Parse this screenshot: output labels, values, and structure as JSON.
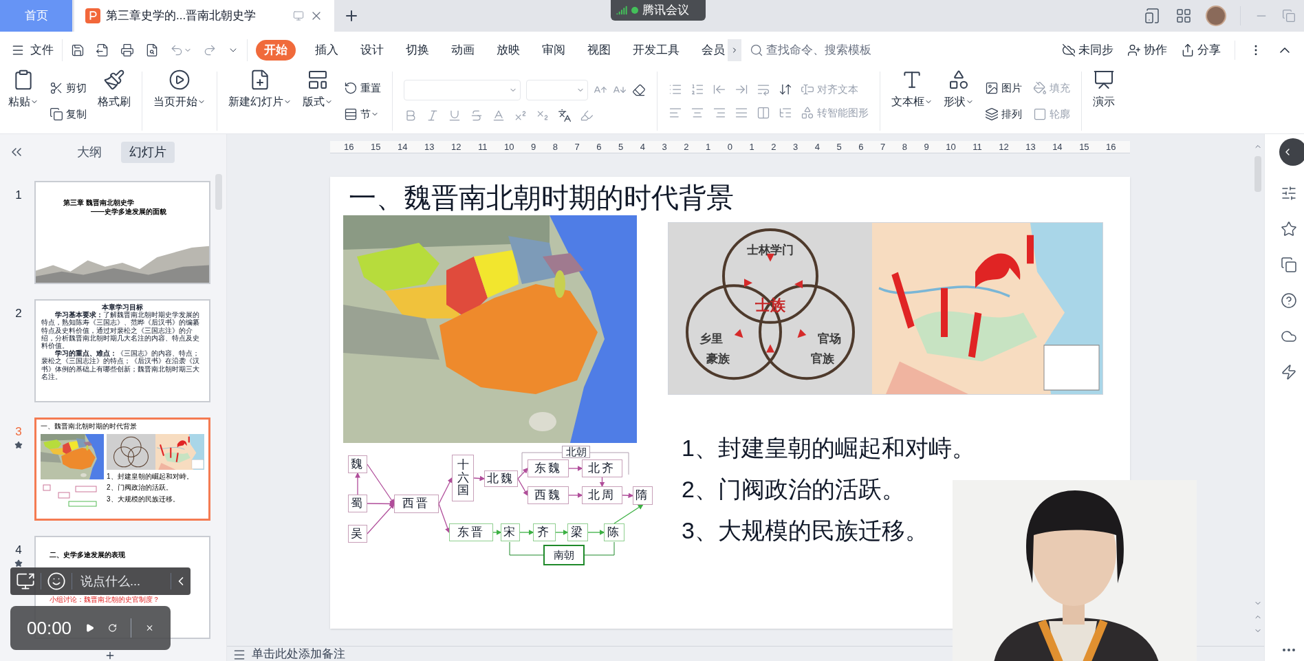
{
  "tabbar": {
    "home": "首页",
    "doc_tab": {
      "title": "第三章史学的...晋南北朝史学",
      "selected": true
    }
  },
  "meeting_badge": "腾讯会议",
  "menu": {
    "file": "文件",
    "tabs": [
      {
        "label": "开始",
        "selected": true
      },
      {
        "label": "插入",
        "selected": false
      },
      {
        "label": "设计",
        "selected": false
      },
      {
        "label": "切换",
        "selected": false
      },
      {
        "label": "动画",
        "selected": false
      },
      {
        "label": "放映",
        "selected": false
      },
      {
        "label": "审阅",
        "selected": false
      },
      {
        "label": "视图",
        "selected": false
      },
      {
        "label": "开发工具",
        "selected": false
      },
      {
        "label": "会员",
        "selected": false
      }
    ],
    "search": {
      "placeholder": "查找命令、搜索模板"
    },
    "right": [
      "未同步",
      "协作",
      "分享"
    ]
  },
  "ribbon": {
    "paste": "粘贴",
    "cut": "剪切",
    "copy": "复制",
    "format_painter": "格式刷",
    "from_current": "当页开始",
    "new_slide": "新建幻灯片",
    "layout": "版式",
    "reset": "重置",
    "section": "节",
    "align_text": {
      "label": "对齐文本",
      "disabled": true
    },
    "smart_art": {
      "label": "转智能图形",
      "disabled": true
    },
    "textbox": "文本框",
    "shape": "形状",
    "picture": {
      "label": "图片",
      "disabled": false
    },
    "arrange": {
      "label": "排列",
      "disabled": false
    },
    "fill": {
      "label": "填充",
      "disabled": true
    },
    "outline": {
      "label": "轮廓",
      "disabled": true
    },
    "present": "演示"
  },
  "sidebar": {
    "tabs": [
      {
        "label": "大纲",
        "selected": false
      },
      {
        "label": "幻灯片",
        "selected": true
      }
    ],
    "slides": [
      {
        "number": "1",
        "selected": false,
        "animated": false,
        "kind": "title",
        "title": "第三章 魏晋南北朝史学",
        "subtitle": "——史学多途发展的面貌"
      },
      {
        "number": "2",
        "selected": false,
        "animated": false,
        "kind": "goals",
        "title": "本章学习目标",
        "paragraphs": [
          "**学习基本要求：**了解魏晋南北朝时期史学发展的特点，熟知陈寿《三国志》、范晔《后汉书》的编纂特点及史料价值，通过对裴松之《三国志注》的介绍，分析魏晋南北朝时期几大名注的内容、特点及史料价值。",
          "**学习的重点、难点：**《三国志》的内容、特点；裴松之《三国志注》的特点；《后汉书》在沿袭《汉书》体例的基础上有哪些创新；魏晋南北朝时期三大名注。"
        ]
      },
      {
        "number": "3",
        "selected": true,
        "animated": true,
        "kind": "background",
        "title": "一、魏晋南北朝时期的时代背景",
        "items": [
          "1、封建皇朝的崛起和对峙。",
          "2、门阀政治的活跃。",
          "3、大规模的民族迁移。"
        ]
      },
      {
        "number": "4",
        "selected": false,
        "animated": true,
        "kind": "discussion",
        "title": "二、史学多途发展的表现",
        "note": "小组讨论：魏晋南北朝的史官制度？"
      }
    ]
  },
  "ruler": [
    "16",
    "15",
    "14",
    "13",
    "12",
    "11",
    "10",
    "9",
    "8",
    "7",
    "6",
    "5",
    "4",
    "3",
    "2",
    "1",
    "0",
    "1",
    "2",
    "3",
    "4",
    "5",
    "6",
    "7",
    "8",
    "9",
    "10",
    "11",
    "12",
    "13",
    "14",
    "15",
    "16"
  ],
  "slide": {
    "title": "一、魏晋南北朝时期的时代背景",
    "venn": {
      "top": "士林学门",
      "center": "士族",
      "left": [
        "乡里",
        "豪族"
      ],
      "right": [
        "官场",
        "官族"
      ]
    },
    "dynasties": [
      {
        "label": "魏",
        "kind": "north"
      },
      {
        "label": "蜀",
        "kind": "north"
      },
      {
        "label": "吴",
        "kind": "north"
      },
      {
        "label": "西晋",
        "kind": "north"
      },
      {
        "label": "十六国",
        "kind": "north"
      },
      {
        "label": "北魏",
        "kind": "north"
      },
      {
        "label": "东魏",
        "kind": "north"
      },
      {
        "label": "北齐",
        "kind": "north"
      },
      {
        "label": "西魏",
        "kind": "north"
      },
      {
        "label": "北周",
        "kind": "north"
      },
      {
        "label": "隋",
        "kind": "north"
      },
      {
        "label": "东晋",
        "kind": "south"
      },
      {
        "label": "宋",
        "kind": "south"
      },
      {
        "label": "齐",
        "kind": "south"
      },
      {
        "label": "梁",
        "kind": "south"
      },
      {
        "label": "陈",
        "kind": "south"
      },
      {
        "label": "北朝",
        "kind": "north_label"
      },
      {
        "label": "南朝",
        "kind": "south_label"
      }
    ],
    "items": [
      "1、封建皇朝的崛起和对峙。",
      "2、门阀政治的活跃。",
      "3、大规模的民族迁移。"
    ]
  },
  "notes": {
    "placeholder": "单击此处添加备注"
  },
  "chat_bar": {
    "placeholder": "说点什么..."
  },
  "timer": {
    "time": "00:00"
  }
}
